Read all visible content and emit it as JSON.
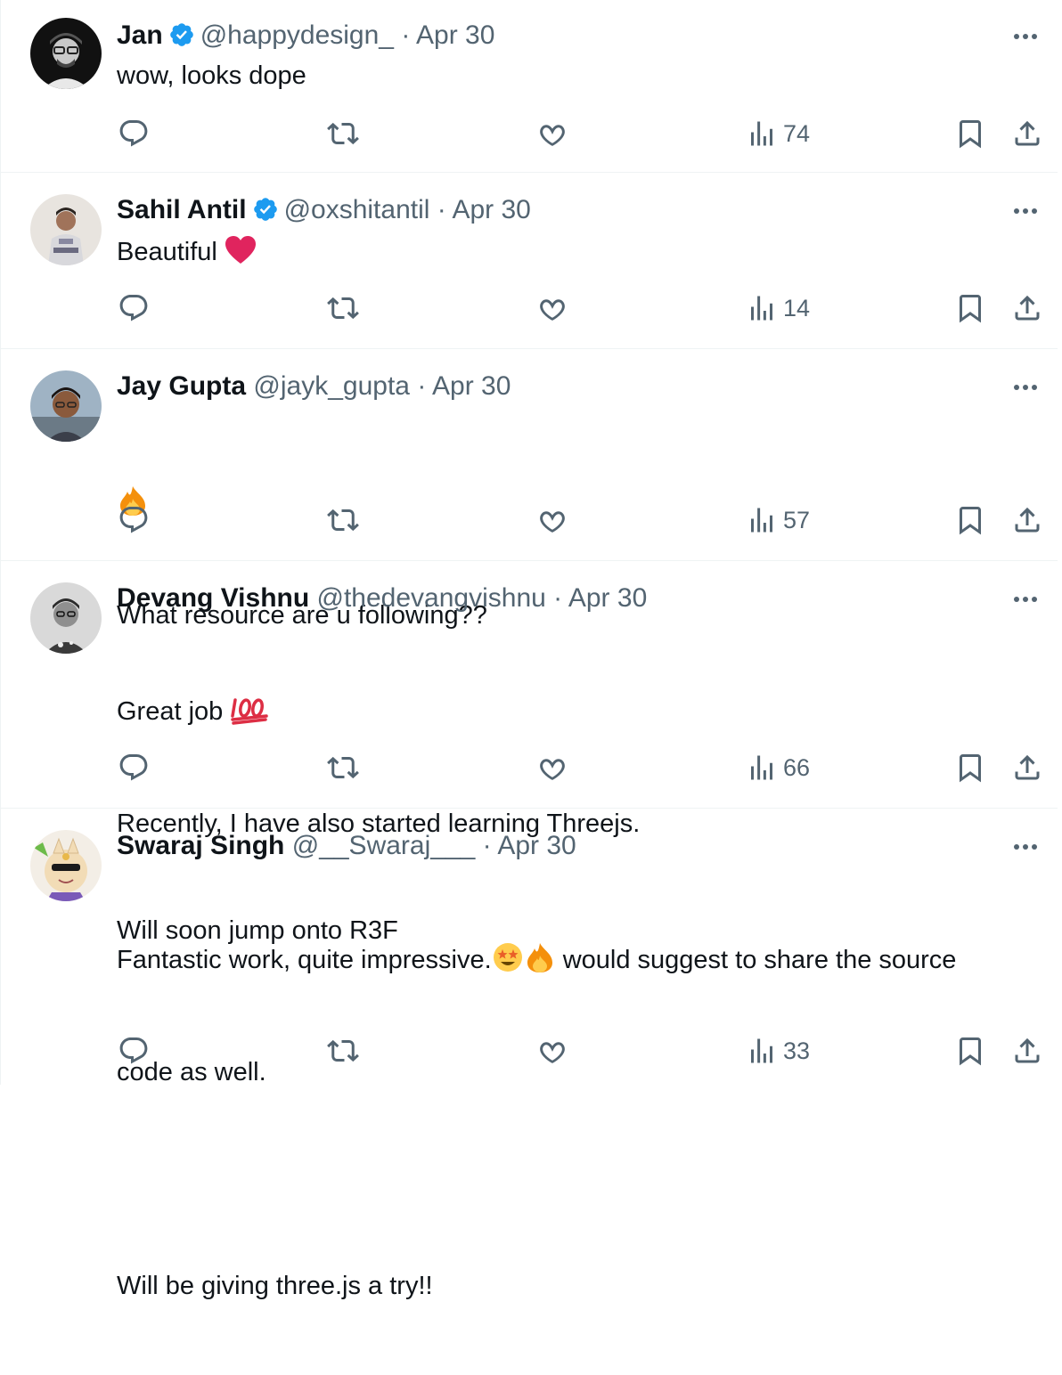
{
  "colors": {
    "text": "#0f1419",
    "secondary": "#536471",
    "verified": "#1d9bf0",
    "border": "#eff3f4",
    "heart": "#e0245e"
  },
  "icons": [
    "reply-icon",
    "retweet-icon",
    "like-icon",
    "views-icon",
    "bookmark-icon",
    "share-icon",
    "more-icon",
    "verified-badge-icon"
  ],
  "replies": [
    {
      "name": "Jan",
      "verified": true,
      "handle": "@happydesign_",
      "dot": "·",
      "date": "Apr 30",
      "lines": [
        "wow, looks dope"
      ],
      "views": "74"
    },
    {
      "name": "Sahil Antil",
      "verified": true,
      "handle": "@oxshitantil",
      "dot": "·",
      "date": "Apr 30",
      "lines": [
        "Beautiful"
      ],
      "views": "14"
    },
    {
      "name": "Jay Gupta",
      "verified": false,
      "handle": "@jayk_gupta",
      "dot": "·",
      "date": "Apr 30",
      "lines": [
        "",
        "What resource are u following??"
      ],
      "views": "57"
    },
    {
      "name": "Devang Vishnu",
      "verified": false,
      "handle": "@thedevangvishnu",
      "dot": "·",
      "date": "Apr 30",
      "lines": [
        "Great job",
        "Recently, I have also started learning Threejs.",
        "Will soon jump onto R3F"
      ],
      "views": "66"
    },
    {
      "name": "Swaraj Singh",
      "verified": false,
      "handle": "@__Swaraj___",
      "dot": "·",
      "date": "Apr 30",
      "lines": [
        "Fantastic work, quite impressive.",
        "would suggest to share the source",
        "code as well.",
        "",
        "Will be giving three.js a try!!"
      ],
      "views": "33"
    }
  ]
}
